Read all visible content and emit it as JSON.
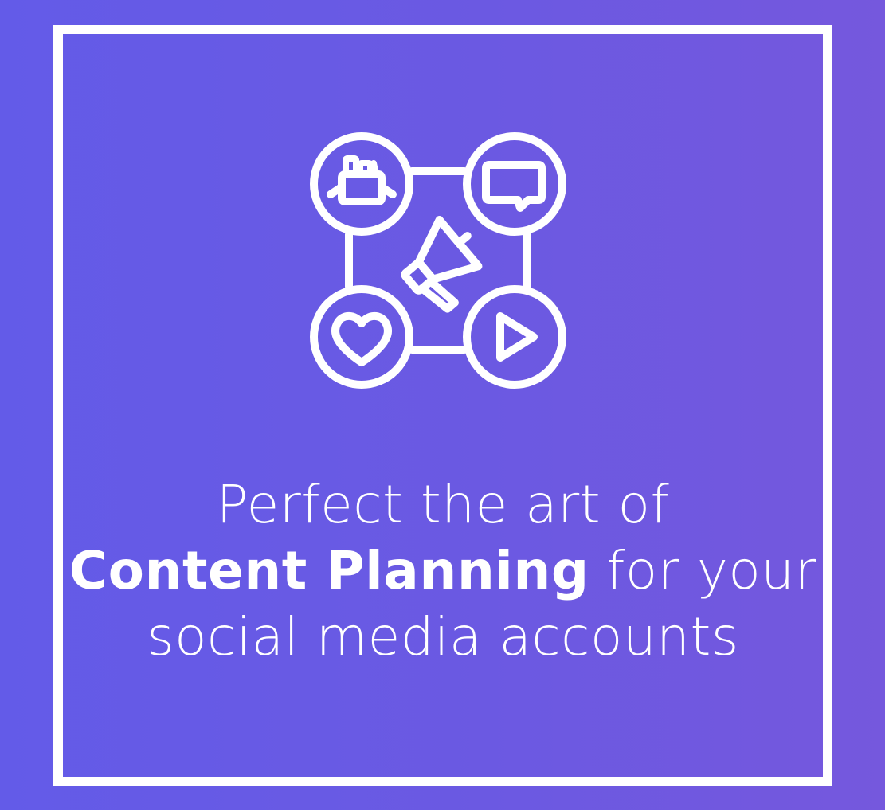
{
  "background": {
    "gradient_start": "#635BE8",
    "gradient_end": "#7558DD"
  },
  "frame_color": "#FFFFFF",
  "emblem": {
    "icons": [
      "shopping-basket-icon",
      "chat-bubble-icon",
      "megaphone-icon",
      "heart-icon",
      "play-icon"
    ]
  },
  "headline": {
    "line1": "Perfect the art of",
    "line2_bold": "Content Planning",
    "line2_rest": " for your",
    "line3": "social media accounts"
  }
}
